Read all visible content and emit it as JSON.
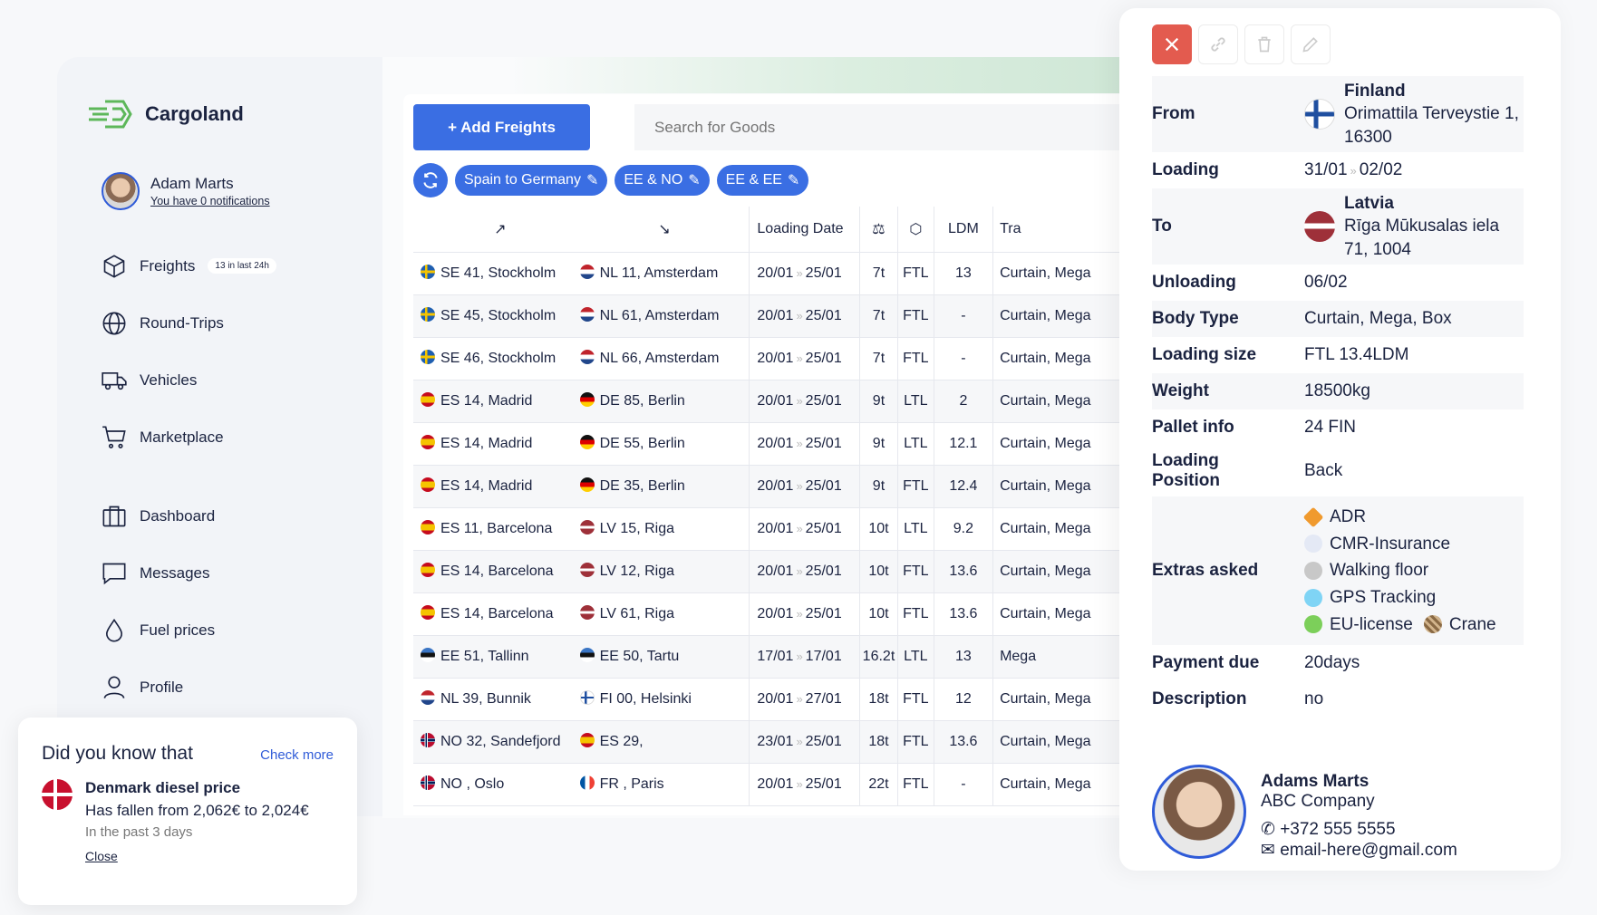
{
  "app": {
    "name": "Cargoland",
    "accent": "#3a6ee3"
  },
  "user": {
    "name": "Adam Marts",
    "notifications": "You have 0 notifications"
  },
  "nav": {
    "freights": "Freights",
    "freights_badge": "13 in last 24h",
    "round_trips": "Round-Trips",
    "vehicles": "Vehicles",
    "marketplace": "Marketplace",
    "dashboard": "Dashboard",
    "messages": "Messages",
    "fuel": "Fuel prices",
    "profile": "Profile"
  },
  "tip": {
    "title": "Did you know that",
    "link": "Check more",
    "heading": "Denmark diesel price",
    "body": "Has fallen from 2,062€ to 2,024€",
    "sub": "In the past 3 days",
    "close": "Close"
  },
  "toolbar": {
    "add": "+ Add Freights",
    "search_placeholder": "Search for Goods"
  },
  "chips": [
    "Spain to Germany",
    "EE & NO",
    "EE & EE"
  ],
  "table": {
    "headers": {
      "from": "↗",
      "to": "↘",
      "date": "Loading Date",
      "ldm": "LDM",
      "trailer": "Tra"
    },
    "rows": [
      {
        "ff": "f-se",
        "from": "SE 41, Stockholm",
        "tf": "f-nl",
        "to": "NL 11, Amsterdam",
        "d1": "20/01",
        "d2": "25/01",
        "w": "7t",
        "t": "FTL",
        "ldm": "13",
        "tr": "Curtain, Mega"
      },
      {
        "ff": "f-se",
        "from": "SE 45, Stockholm",
        "tf": "f-nl",
        "to": "NL 61, Amsterdam",
        "d1": "20/01",
        "d2": "25/01",
        "w": "7t",
        "t": "FTL",
        "ldm": "-",
        "tr": "Curtain, Mega"
      },
      {
        "ff": "f-se",
        "from": "SE 46, Stockholm",
        "tf": "f-nl",
        "to": "NL 66, Amsterdam",
        "d1": "20/01",
        "d2": "25/01",
        "w": "7t",
        "t": "FTL",
        "ldm": "-",
        "tr": "Curtain, Mega"
      },
      {
        "ff": "f-es",
        "from": "ES 14, Madrid",
        "tf": "f-de",
        "to": "DE 85, Berlin",
        "d1": "20/01",
        "d2": "25/01",
        "w": "9t",
        "t": "LTL",
        "ldm": "2",
        "tr": "Curtain, Mega"
      },
      {
        "ff": "f-es",
        "from": "ES 14, Madrid",
        "tf": "f-de",
        "to": "DE 55, Berlin",
        "d1": "20/01",
        "d2": "25/01",
        "w": "9t",
        "t": "LTL",
        "ldm": "12.1",
        "tr": "Curtain, Mega"
      },
      {
        "ff": "f-es",
        "from": "ES 14, Madrid",
        "tf": "f-de",
        "to": "DE 35, Berlin",
        "d1": "20/01",
        "d2": "25/01",
        "w": "9t",
        "t": "FTL",
        "ldm": "12.4",
        "tr": "Curtain, Mega"
      },
      {
        "ff": "f-es",
        "from": "ES 11, Barcelona",
        "tf": "f-lv",
        "to": "LV 15, Riga",
        "d1": "20/01",
        "d2": "25/01",
        "w": "10t",
        "t": "LTL",
        "ldm": "9.2",
        "tr": "Curtain, Mega"
      },
      {
        "ff": "f-es",
        "from": "ES 14, Barcelona",
        "tf": "f-lv",
        "to": "LV 12, Riga",
        "d1": "20/01",
        "d2": "25/01",
        "w": "10t",
        "t": "FTL",
        "ldm": "13.6",
        "tr": "Curtain, Mega"
      },
      {
        "ff": "f-es",
        "from": "ES 14, Barcelona",
        "tf": "f-lv",
        "to": "LV 61, Riga",
        "d1": "20/01",
        "d2": "25/01",
        "w": "10t",
        "t": "FTL",
        "ldm": "13.6",
        "tr": "Curtain, Mega"
      },
      {
        "ff": "f-ee",
        "from": "EE 51, Tallinn",
        "tf": "f-ee",
        "to": "EE 50, Tartu",
        "d1": "17/01",
        "d2": "17/01",
        "w": "16.2t",
        "t": "LTL",
        "ldm": "13",
        "tr": "Mega"
      },
      {
        "ff": "f-nl",
        "from": "NL 39, Bunnik",
        "tf": "f-fi",
        "to": "FI 00, Helsinki",
        "d1": "20/01",
        "d2": "27/01",
        "w": "18t",
        "t": "FTL",
        "ldm": "12",
        "tr": "Curtain, Mega"
      },
      {
        "ff": "f-no",
        "from": "NO 32, Sandefjord",
        "tf": "f-es",
        "to": "ES 29,",
        "d1": "23/01",
        "d2": "25/01",
        "w": "18t",
        "t": "FTL",
        "ldm": "13.6",
        "tr": "Curtain, Mega"
      },
      {
        "ff": "f-no",
        "from": "NO , Oslo",
        "tf": "f-fr",
        "to": "FR , Paris",
        "d1": "20/01",
        "d2": "25/01",
        "w": "22t",
        "t": "FTL",
        "ldm": "-",
        "tr": "Curtain, Mega"
      }
    ]
  },
  "detail": {
    "from_label": "From",
    "from_country": "Finland",
    "from_address": "Orimattila Terveystie 1, 16300",
    "loading_label": "Loading",
    "loading_from": "31/01",
    "loading_to": "02/02",
    "to_label": "To",
    "to_country": "Latvia",
    "to_address": "Rīga Mūkusalas iela 71, 1004",
    "unloading_label": "Unloading",
    "unloading": "06/02",
    "body_label": "Body Type",
    "body": "Curtain, Mega, Box",
    "size_label": "Loading size",
    "size": "FTL 13.4LDM",
    "weight_label": "Weight",
    "weight": "18500kg",
    "pallet_label": "Pallet info",
    "pallet": "24 FIN",
    "position_label": "Loading Position",
    "position": "Back",
    "extras_label": "Extras asked",
    "extras": {
      "adr": "ADR",
      "cmr": "CMR-Insurance",
      "walking": "Walking floor",
      "gps": "GPS Tracking",
      "eu": "EU-license",
      "crane": "Crane"
    },
    "payment_label": "Payment due",
    "payment": "20days",
    "desc_label": "Description",
    "desc": "no"
  },
  "contact": {
    "name": "Adams Marts",
    "company": "ABC Company",
    "phone": "+372 555 5555",
    "email": "email-here@gmail.com"
  }
}
